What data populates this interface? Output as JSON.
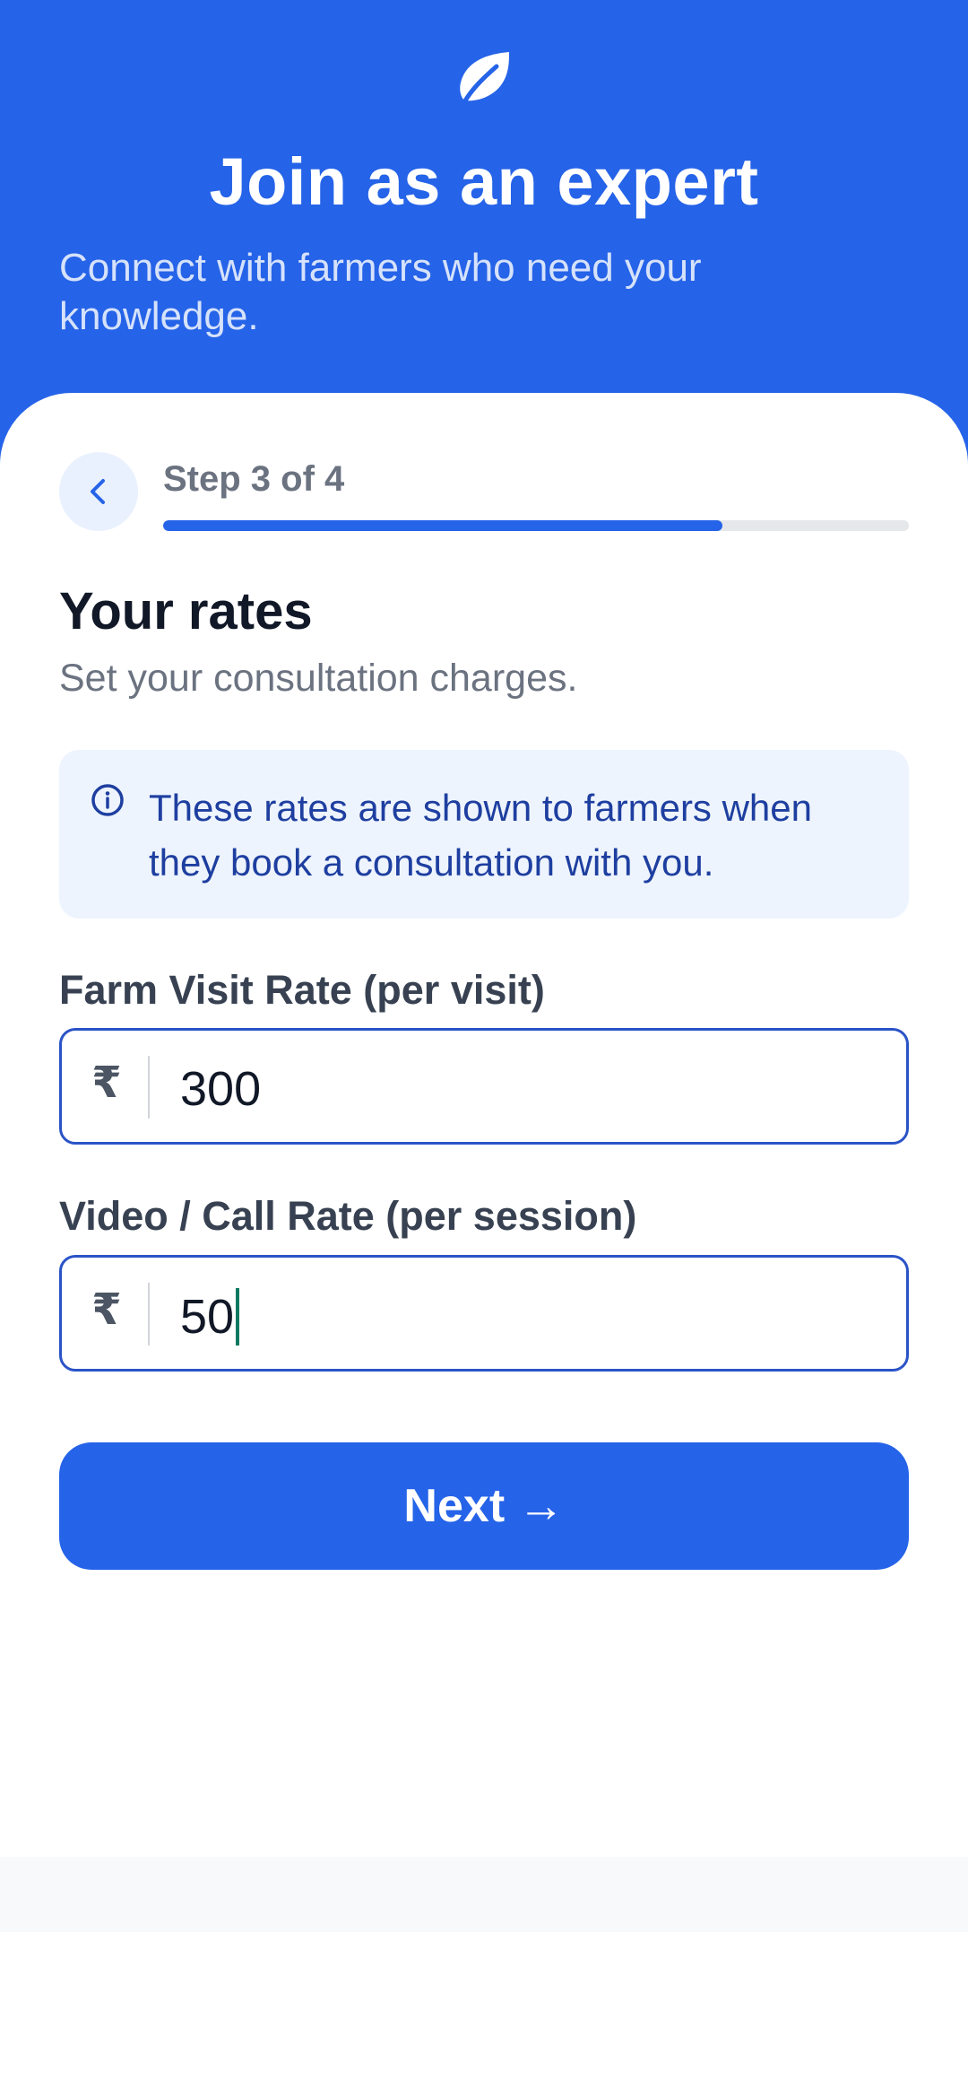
{
  "header": {
    "logo_icon": "leaf-icon",
    "title": "Join as an expert",
    "subtitle": "Connect with farmers who need your knowledge."
  },
  "progress": {
    "step_label": "Step 3 of 4",
    "current_step": 3,
    "total_steps": 4,
    "fill_fraction": 0.75,
    "back_icon": "chevron-left-icon"
  },
  "section": {
    "title": "Your rates",
    "subtitle": "Set your consultation charges."
  },
  "info": {
    "icon": "info-icon",
    "text": "These rates are shown to farmers when they book a consultation with you."
  },
  "fields": {
    "farm_visit": {
      "label": "Farm Visit Rate (per visit)",
      "currency": "₹",
      "value": "300"
    },
    "video_call": {
      "label": "Video / Call Rate (per session)",
      "currency": "₹",
      "value": "50"
    }
  },
  "actions": {
    "next_label": "Next →"
  },
  "colors": {
    "primary": "#2563E8",
    "info_bg": "#EEF4FE",
    "info_text": "#1E3FA0",
    "caret": "#0F7A5F"
  }
}
